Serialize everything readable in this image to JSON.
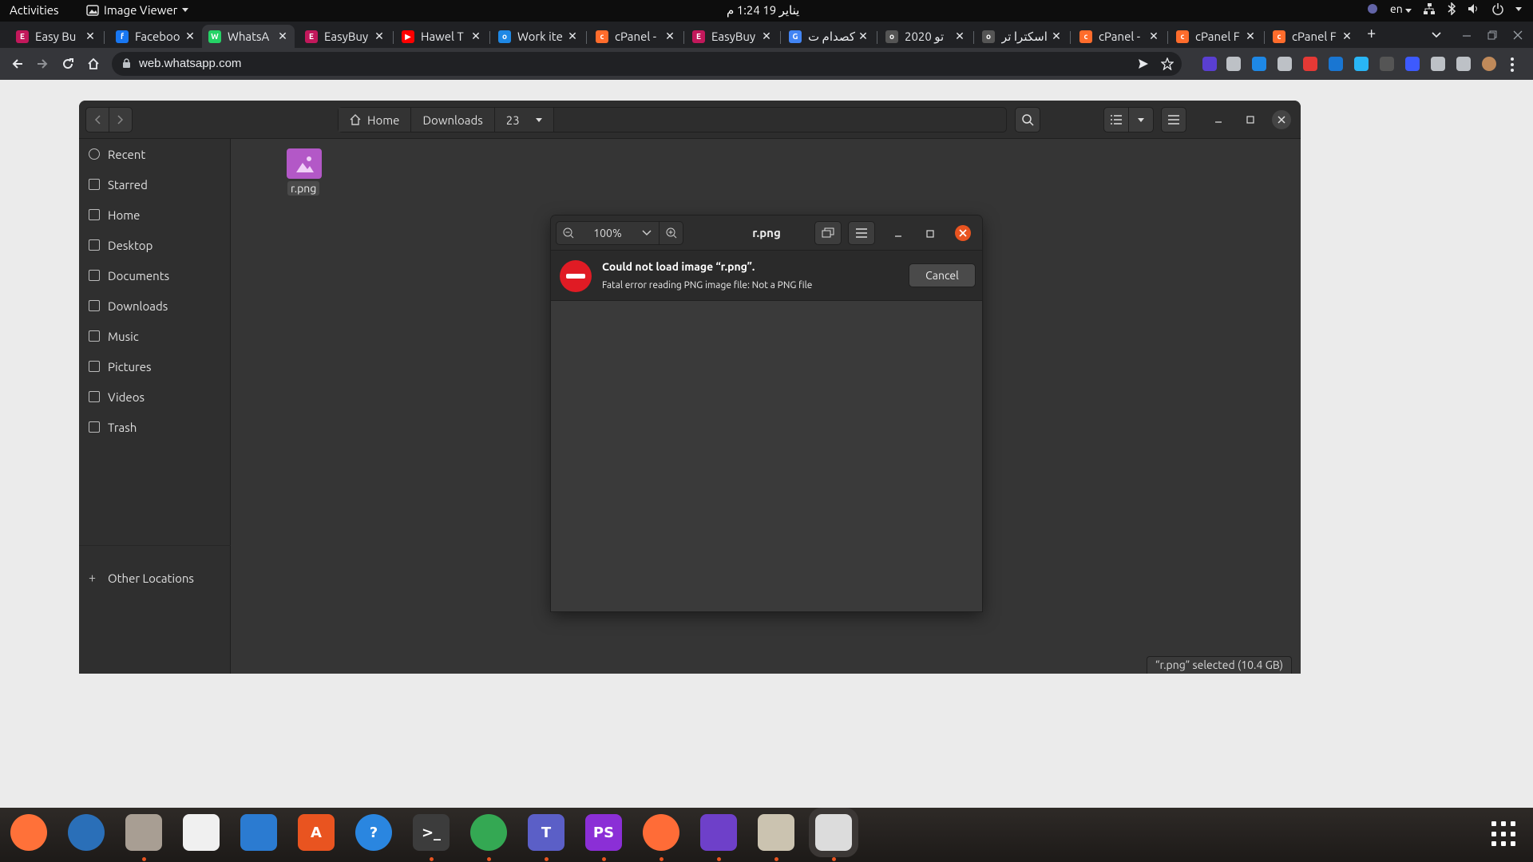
{
  "topbar": {
    "activities": "Activities",
    "app_menu": "Image Viewer",
    "clock": "يناير 19 1:24 م",
    "lang": "en"
  },
  "tabs": [
    {
      "title": "Easy Bu",
      "color": "#c2185b",
      "glyph": "E"
    },
    {
      "title": "Faceboo",
      "color": "#1877f2",
      "glyph": "f"
    },
    {
      "title": "WhatsA",
      "color": "#25d366",
      "glyph": "W"
    },
    {
      "title": "EasyBuy",
      "color": "#c2185b",
      "glyph": "E"
    },
    {
      "title": "Hawel T",
      "color": "#ff0000",
      "glyph": "▶"
    },
    {
      "title": "Work ite",
      "color": "#1e88e5",
      "glyph": "o"
    },
    {
      "title": "cPanel -",
      "color": "#ff6c2c",
      "glyph": "c"
    },
    {
      "title": "EasyBuy",
      "color": "#c2185b",
      "glyph": "E"
    },
    {
      "title": "اكصدام ت",
      "color": "#4285f4",
      "glyph": "G"
    },
    {
      "title": "2020 تو",
      "color": "#555555",
      "glyph": "o"
    },
    {
      "title": "اسكترا تر",
      "color": "#555555",
      "glyph": "o"
    },
    {
      "title": "cPanel -",
      "color": "#ff6c2c",
      "glyph": "c"
    },
    {
      "title": "cPanel F",
      "color": "#ff6c2c",
      "glyph": "c"
    },
    {
      "title": "cPanel F",
      "color": "#ff6c2c",
      "glyph": "c"
    }
  ],
  "tab_close": "✕",
  "new_tab": "+",
  "address": {
    "url": "web.whatsapp.com"
  },
  "files": {
    "path": [
      "Home",
      "Downloads",
      "23"
    ],
    "sidebar": [
      "Recent",
      "Starred",
      "Home",
      "Desktop",
      "Documents",
      "Downloads",
      "Music",
      "Pictures",
      "Videos",
      "Trash"
    ],
    "other_locations": "Other Locations",
    "file_name": "r.png",
    "status": "“r.png” selected  (10.4 GB)"
  },
  "viewer": {
    "title": "r.png",
    "zoom": "100%",
    "error_title": "Could not load image “r.png”.",
    "error_message": "Fatal error reading PNG image file: Not a PNG file",
    "cancel_label": "Cancel"
  },
  "dock": [
    {
      "name": "firefox",
      "color": "#ff7139",
      "label": "",
      "running": false
    },
    {
      "name": "thunderbird",
      "color": "#2a6fb8",
      "label": "",
      "running": false
    },
    {
      "name": "files",
      "color": "#a89e93",
      "label": "",
      "running": true
    },
    {
      "name": "rhythmbox",
      "color": "#f0f0f0",
      "label": "",
      "running": false
    },
    {
      "name": "writer",
      "color": "#2b7bd1",
      "label": "",
      "running": false
    },
    {
      "name": "software",
      "color": "#e95420",
      "label": "A",
      "running": false
    },
    {
      "name": "help",
      "color": "#2a86e0",
      "label": "?",
      "running": false
    },
    {
      "name": "terminal",
      "color": "#3c3c3c",
      "label": ">_",
      "running": true
    },
    {
      "name": "chrome",
      "color": "#34a853",
      "label": "",
      "running": true
    },
    {
      "name": "teams",
      "color": "#5b5fc7",
      "label": "T",
      "running": true
    },
    {
      "name": "phpstorm",
      "color": "#8b2fd6",
      "label": "PS",
      "running": true
    },
    {
      "name": "postman",
      "color": "#ff6c37",
      "label": "",
      "running": true
    },
    {
      "name": "github",
      "color": "#6e40c9",
      "label": "",
      "running": true
    },
    {
      "name": "archive",
      "color": "#cbc3b0",
      "label": "",
      "running": true
    },
    {
      "name": "image-viewer",
      "color": "#dcdcdc",
      "label": "",
      "running": true
    }
  ]
}
